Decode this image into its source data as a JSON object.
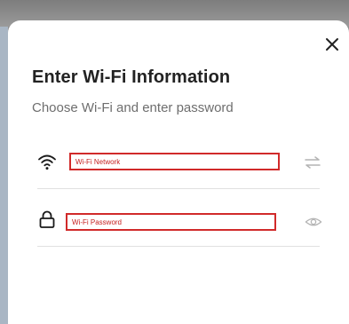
{
  "dialog": {
    "title": "Enter Wi-Fi Information",
    "subtitle": "Choose Wi-Fi and enter password"
  },
  "wifi_network": {
    "placeholder": "Wi-Fi Network",
    "value": "",
    "icon": "wifi-icon",
    "action_icon": "swap-arrows-icon"
  },
  "wifi_password": {
    "placeholder": "Wi-Fi Password",
    "value": "",
    "icon": "lock-icon",
    "action_icon": "eye-icon"
  },
  "colors": {
    "field_border": "#d12a2a",
    "title_text": "#222222",
    "subtitle_text": "#6e6e6e",
    "icon_muted": "#b3b3b3"
  }
}
